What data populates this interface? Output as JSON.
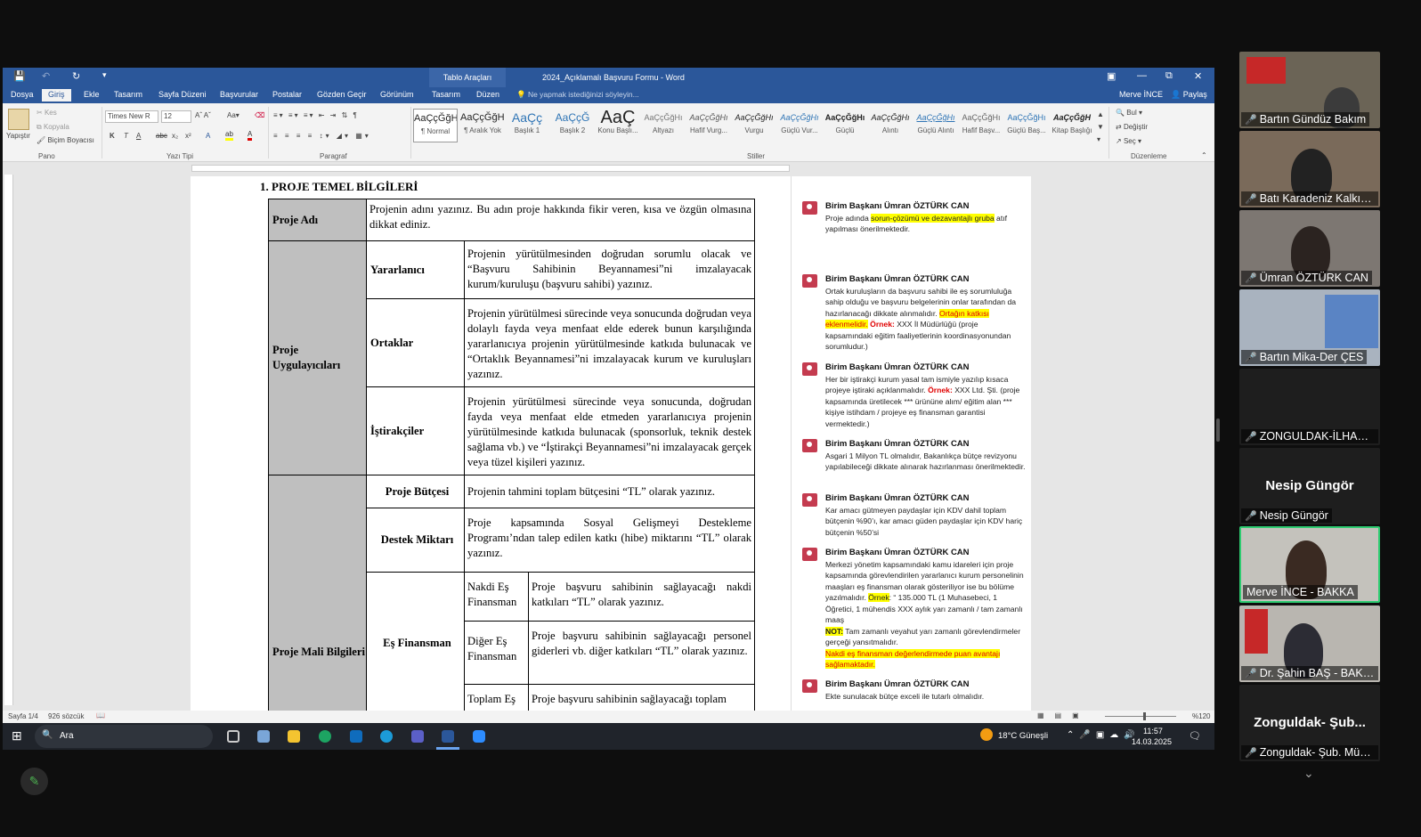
{
  "window": {
    "context_tab": "Tablo Araçları",
    "title": "2024_Açıklamalı Başvuru Formu - Word",
    "user": "Merve İNCE",
    "share": "Paylaş"
  },
  "tabs": [
    "Dosya",
    "Giriş",
    "Ekle",
    "Tasarım",
    "Sayfa Düzeni",
    "Başvurular",
    "Postalar",
    "Gözden Geçir",
    "Görünüm",
    "Tasarım",
    "Düzen"
  ],
  "tell_me": "Ne yapmak istediğinizi söyleyin...",
  "ribbon": {
    "clipboard": {
      "paste": "Yapıştır",
      "cut": "Kes",
      "copy": "Kopyala",
      "format_painter": "Biçim Boyacısı",
      "label": "Pano"
    },
    "font": {
      "name": "Times New R",
      "size": "12",
      "label": "Yazı Tipi"
    },
    "paragraph_label": "Paragraf",
    "styles": [
      {
        "sample": "AaÇçĞğHı",
        "name": "¶ Normal"
      },
      {
        "sample": "AaÇçĞğHı",
        "name": "¶ Aralık Yok"
      },
      {
        "sample": "AaÇç",
        "name": "Başlık 1"
      },
      {
        "sample": "AaÇçĞ",
        "name": "Başlık 2"
      },
      {
        "sample": "AaÇ",
        "name": "Konu Başlı..."
      },
      {
        "sample": "AaÇçĞğHı",
        "name": "Altyazı"
      },
      {
        "sample": "AaÇçĞğHı",
        "name": "Hafif Vurg..."
      },
      {
        "sample": "AaÇçĞğHı",
        "name": "Vurgu"
      },
      {
        "sample": "AaÇçĞğHı",
        "name": "Güçlü Vur..."
      },
      {
        "sample": "AaÇçĞğHı",
        "name": "Güçlü"
      },
      {
        "sample": "AaÇçĞğHı",
        "name": "Alıntı"
      },
      {
        "sample": "AaÇçĞğHı",
        "name": "Güçlü Alıntı"
      },
      {
        "sample": "AaÇçĞğHı",
        "name": "Hafif Başv..."
      },
      {
        "sample": "AaÇçĞğHı",
        "name": "Güçlü Baş..."
      },
      {
        "sample": "AaÇçĞğH",
        "name": "Kitap Başlığı"
      }
    ],
    "styles_label": "Stiller",
    "editing": {
      "find": "Bul",
      "replace": "Değiştir",
      "select": "Seç",
      "label": "Düzenleme"
    }
  },
  "document": {
    "heading": "1. PROJE TEMEL BİLGİLERİ",
    "rows": {
      "proje_adi": {
        "label": "Proje Adı",
        "text": "Projenin adını yazınız. Bu adın proje hakkında fikir veren, kısa ve özgün olmasına dikkat ediniz."
      },
      "uygulayicilar": "Proje Uygulayıcıları",
      "yararlanici": {
        "label": "Yararlanıcı",
        "text": "Projenin yürütülmesinden doğrudan sorumlu olacak ve “Başvuru Sahibinin Beyannamesi”ni imzalayacak kurum/kuruluşu (başvuru sahibi) yazınız."
      },
      "ortaklar": {
        "label": "Ortaklar",
        "text": "Projenin yürütülmesi sürecinde veya sonucunda doğrudan veya dolaylı fayda veya menfaat elde ederek bunun karşılığında yararlanıcıya projenin yürütülmesinde katkıda bulunacak ve “Ortaklık Beyannamesi”ni imzalayacak kurum ve kuruluşları yazınız."
      },
      "istirakciler": {
        "label": "İştirakçiler",
        "text": "Projenin yürütülmesi sürecinde veya sonucunda, doğrudan fayda veya menfaat elde etmeden yararlanıcıya projenin yürütülmesinde katkıda bulunacak (sponsorluk, teknik destek sağlama vb.) ve “İştirakçi Beyannamesi”ni imzalayacak gerçek veya tüzel kişileri yazınız."
      },
      "mali": "Proje Mali Bilgileri",
      "butce": {
        "label": "Proje Bütçesi",
        "text": "Projenin tahmini toplam bütçesini “TL” olarak yazınız."
      },
      "destek": {
        "label": "Destek Miktarı",
        "text": "Proje kapsamında Sosyal Gelişmeyi Destekleme Programı’ndan talep edilen katkı (hibe) miktarını “TL” olarak yazınız."
      },
      "es_finansman": "Eş Finansman",
      "nakdi": {
        "label": "Nakdi Eş Finansman",
        "text": "Proje başvuru sahibinin sağlayacağı nakdi katkıları “TL” olarak yazınız."
      },
      "diger": {
        "label": "Diğer Eş Finansman",
        "text": "Proje başvuru sahibinin sağlayacağı personel giderleri vb. diğer katkıları “TL” olarak yazınız."
      },
      "toplam": {
        "label": "Toplam Eş",
        "text": "Proje başvuru sahibinin sağlayacağı toplam"
      }
    }
  },
  "comments": {
    "author": "Birim Başkanı Ümran ÖZTÜRK CAN",
    "c1": {
      "a": "Proje adında ",
      "hl": "sorun-çözümü ve dezavantajlı gruba",
      "b": " atıf yapılması önerilmektedir."
    },
    "c2": {
      "a": "Ortak kuruluşların da başvuru sahibi ile eş sorumluluğa sahip olduğu ve başvuru belgelerinin onlar tarafından da hazırlanacağı dikkate alınmalıdır. ",
      "hl": "Ortağın katkısı eklenmelidir.",
      "ex": " Örnek:",
      "b": " XXX İl Müdürlüğü (proje kapsamındaki eğitim faaliyetlerinin koordinasyonundan sorumludur.)"
    },
    "c3": {
      "a": "Her bir iştirakçi kurum yasal tam ismiyle yazılıp kısaca projeye iştiraki açıklanmalıdır. ",
      "ex": "Örnek:",
      "b": " XXX Ltd. Şti. (proje kapsamında üretilecek *** ürününe alım/ eğitim alan *** kişiye istihdam / projeye eş finansman garantisi vermektedir.)"
    },
    "c4": "Asgari 1 Milyon TL olmalıdır, Bakanlıkça bütçe revizyonu yapılabileceği dikkate alınarak hazırlanması önerilmektedir.",
    "c5": "Kar amacı gütmeyen paydaşlar için KDV dahil toplam bütçenin %90’ı, kar amacı güden paydaşlar için KDV hariç bütçenin %50’si",
    "c6": {
      "a": "Merkezi yönetim kapsamındaki kamu idareleri için proje kapsamında görevlendirilen yararlanıcı kurum personelinin maaşları eş finansman olarak gösteriliyor ise bu bölüme yazılmalıdır. ",
      "ex": "Örnek",
      "b": ": “ 135.000 TL (1 Muhasebeci, 1 Öğretici, 1 mühendis XXX aylık yarı zamanlı / tam zamanlı maaş",
      "not": "NOT:",
      "c": " Tam zamanlı veyahut yarı zamanlı görevlendirmeler gerçeği yansıtmalıdır.",
      "red": "Nakdi eş finansman değerlendirmede puan avantajı sağlamaktadır."
    },
    "c7": "Ekte sunulacak bütçe exceli ile tutarlı olmalıdır."
  },
  "status": {
    "page": "Sayfa 1/4",
    "words": "926 sözcük",
    "zoom": "%120"
  },
  "taskbar": {
    "search": "Ara",
    "weather": "18°C  Güneşli",
    "time": "11:57",
    "date": "14.03.2025"
  },
  "participants": [
    "Bartın Gündüz Bakım",
    "Batı Karadeniz Kalkın...",
    "Ümran ÖZTÜRK CAN",
    "Bartın Mika-Der ÇES",
    "ZONGULDAK-İLHAN ...",
    "Nesip Güngör",
    "Merve İNCE - BAKKA",
    "Dr. Şahin BAŞ - BAKK...",
    "Zonguldak- Şub. Müd..."
  ],
  "participant_big": {
    "nesip": "Nesip Güngör",
    "zonguldak": "Zonguldak- Şub..."
  }
}
